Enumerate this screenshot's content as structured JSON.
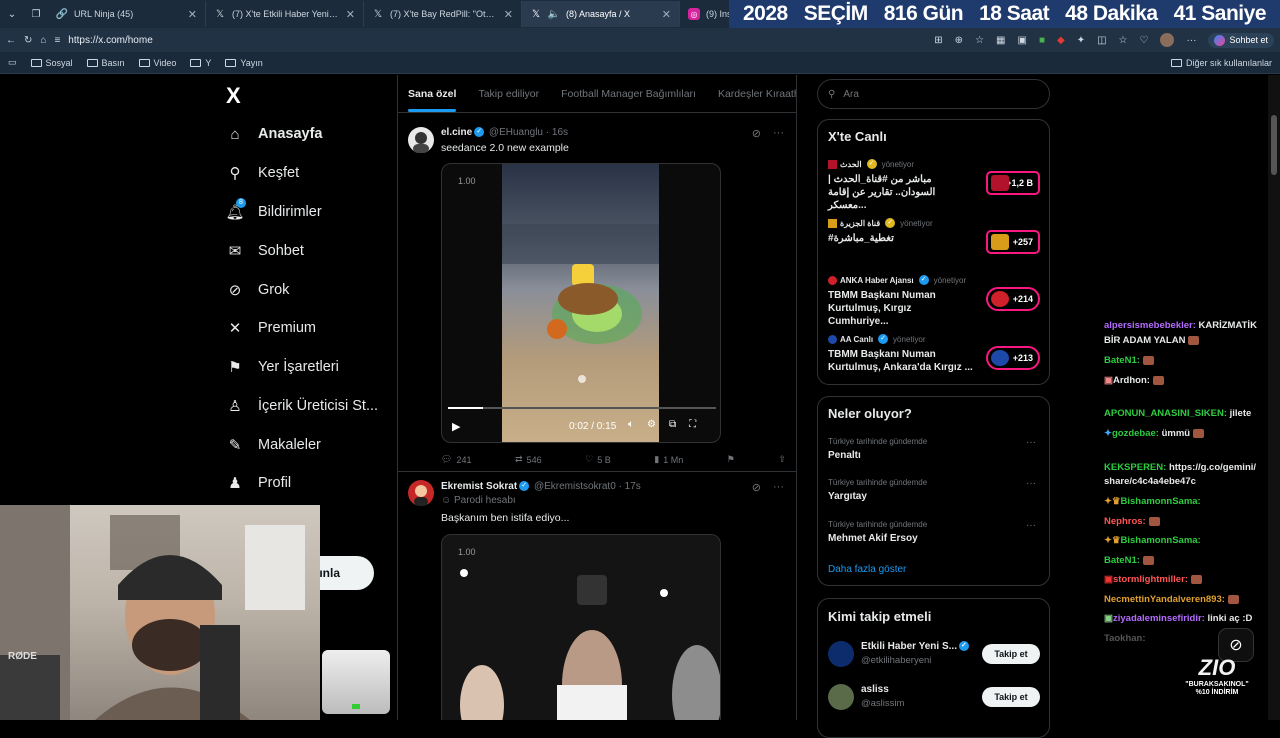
{
  "browser": {
    "tabs": [
      {
        "title": "URL Ninja (45)",
        "icon": "link-icon"
      },
      {
        "title": "(7) X'te Etkili Haber Yeni Sayfa: \"Et",
        "icon": "x-logo-icon"
      },
      {
        "title": "(7) X'te Bay RedPill: \"Otuzlarındaki",
        "icon": "x-logo-icon"
      },
      {
        "title": "(8) Anasayfa / X",
        "icon": "x-logo-icon",
        "active": true
      },
      {
        "title": "(9) Instag",
        "icon": "instagram-icon"
      }
    ],
    "url": "https://x.com/home",
    "chat_button": "Sohbet et",
    "bookmarks": [
      "Sosyal",
      "Basın",
      "Video",
      "Y",
      "Yayın"
    ],
    "other_bookmarks": "Diğer sık kullanılanlar"
  },
  "countdown": {
    "year": "2028",
    "label": "SEÇİM",
    "days": "816 Gün",
    "hours": "18 Saat",
    "minutes": "48 Dakika",
    "seconds": "41 Saniye"
  },
  "sidebar": {
    "logo": "X",
    "items": [
      {
        "label": "Anasayfa",
        "icon": "home-icon"
      },
      {
        "label": "Keşfet",
        "icon": "search-icon"
      },
      {
        "label": "Bildirimler",
        "icon": "bell-icon",
        "badge": "8"
      },
      {
        "label": "Sohbet",
        "icon": "mail-icon"
      },
      {
        "label": "Grok",
        "icon": "grok-icon"
      },
      {
        "label": "Premium",
        "icon": "x-logo-icon"
      },
      {
        "label": "Yer İşaretleri",
        "icon": "bookmark-icon"
      },
      {
        "label": "İçerik Üreticisi St...",
        "icon": "creator-icon"
      },
      {
        "label": "Makaleler",
        "icon": "article-icon"
      },
      {
        "label": "Profil",
        "icon": "user-icon"
      }
    ],
    "more_fragment": "a",
    "post_button_fragment": "ınla"
  },
  "timeline": {
    "tabs": [
      "Sana özel",
      "Takip ediliyor",
      "Football Manager Bağımlıları",
      "Kardeşler Kıraath"
    ],
    "tweets": [
      {
        "name": "el.cine",
        "handle": "@EHuanglu",
        "time": "16s",
        "text": "seedance 2.0 new example",
        "video_badge": "1.00",
        "video_time": "0:02 / 0:15",
        "progress": 0.13,
        "replies": "241",
        "reposts": "546",
        "likes": "5 B",
        "views": "1 Mn"
      },
      {
        "name": "Ekremist Sokrat",
        "handle": "@Ekremistsokrat0",
        "time": "17s",
        "parody": "Parodi hesabı",
        "text": "Başkanım ben istifa ediyo...",
        "video_badge": "1.00"
      }
    ]
  },
  "right": {
    "search_placeholder": "Ara",
    "live": {
      "title": "X'te Canlı",
      "role": "yönetiyor",
      "items": [
        {
          "source": "الحدث",
          "text": "مباشر من #قناة_الحدث | السودان.. تقارير عن إقامة معسكر...",
          "count": "+1,2 B",
          "color": "#b3122c"
        },
        {
          "source": "قناة الجزيرة",
          "text": "#تغطية_مباشرة",
          "count": "+257",
          "color": "#d89b1a"
        },
        {
          "source": "ANKA Haber Ajansı",
          "text": "TBMM Başkanı Numan Kurtulmuş, Kırgız Cumhuriye...",
          "count": "+214",
          "color": "#d0202a"
        },
        {
          "source": "AA Canlı",
          "text": "TBMM Başkanı Numan Kurtulmuş, Ankara'da Kırgız ...",
          "count": "+213",
          "color": "#1d4aa8"
        }
      ]
    },
    "trends": {
      "title": "Neler oluyor?",
      "items": [
        {
          "category": "Türkiye tarihinde gündemde",
          "name": "Penaltı"
        },
        {
          "category": "Türkiye tarihinde gündemde",
          "name": "Yargıtay"
        },
        {
          "category": "Türkiye tarihinde gündemde",
          "name": "Mehmet Akif Ersoy"
        }
      ],
      "more": "Daha fazla göster"
    },
    "follow": {
      "title": "Kimi takip etmeli",
      "button": "Takip et",
      "items": [
        {
          "name": "Etkili Haber Yeni S...",
          "handle": "@etkilihaberyeni"
        },
        {
          "name": "asliss",
          "handle": "@aslissim"
        }
      ]
    }
  },
  "chat": {
    "messages": [
      {
        "user": "alpersismebebekler:",
        "text": "KARİZMATİK",
        "color": "#b36bff"
      },
      {
        "user": "",
        "text": "BİR ADAM YALAN",
        "color": "#ffffff"
      },
      {
        "user": "BateN1:",
        "text": "",
        "color": "#2ecc40"
      },
      {
        "user": "Ardhon:",
        "text": "",
        "color": "#ffffff"
      },
      {
        "user": "APONUN_ANASINI_SIKEN:",
        "text": "jilete",
        "color": "#2ecc40"
      },
      {
        "user": "gozdebae:",
        "text": "ümmü",
        "color": "#2ecc40"
      },
      {
        "user": "KEKSPEREN:",
        "text": "https://g.co/gemini/",
        "color": "#2ecc40"
      },
      {
        "user": "",
        "text": "share/c4c4a4ebe47c",
        "color": "#ffffff"
      },
      {
        "user": "BishamonnSama:",
        "text": "",
        "color": "#2ecc40"
      },
      {
        "user": "Nephros:",
        "text": "",
        "color": "#ff5555"
      },
      {
        "user": "BishamonnSama:",
        "text": "",
        "color": "#2ecc40"
      },
      {
        "user": "BateN1:",
        "text": "",
        "color": "#2ecc40"
      },
      {
        "user": "stormlightmiller:",
        "text": "",
        "color": "#ff5555"
      },
      {
        "user": "NecmettinYandalveren893:",
        "text": "",
        "color": "#e0a030"
      },
      {
        "user": "ziyadaleminsefiridir:",
        "text": "linki aç :D",
        "color": "#b36bff"
      },
      {
        "user": "Taokhan:",
        "text": "",
        "color": "#555555"
      }
    ]
  },
  "brand": {
    "logo": "ZIO",
    "promo_code": "\"BURAKSAKINOL\"",
    "promo_discount": "%10 İNDİRİM"
  },
  "webcam": {
    "mic_label": "RØDE"
  }
}
